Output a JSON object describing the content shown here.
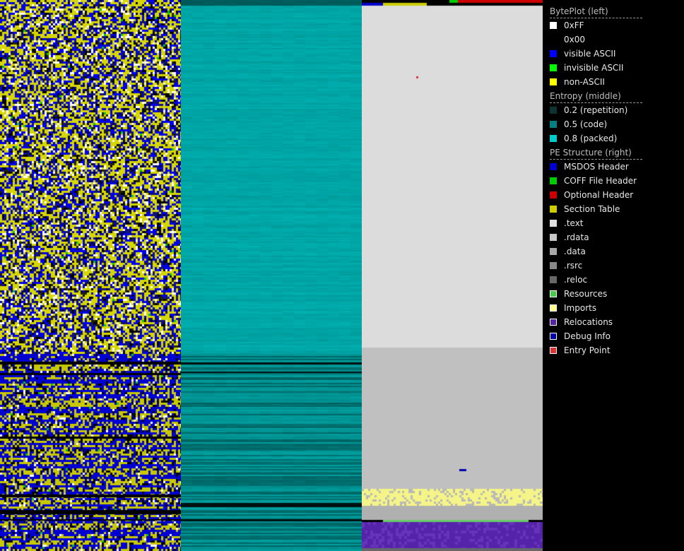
{
  "legend": {
    "sections": [
      {
        "title": "BytePlot (left)",
        "items": [
          {
            "label": "0xFF",
            "color": "#ffffff"
          },
          {
            "label": "0x00",
            "color": "#000000"
          },
          {
            "label": "visible ASCII",
            "color": "#0000ff"
          },
          {
            "label": "invisible ASCII",
            "color": "#00ff00"
          },
          {
            "label": "non-ASCII",
            "color": "#ffff00"
          }
        ]
      },
      {
        "title": "Entropy (middle)",
        "items": [
          {
            "label": "0.2 (repetition)",
            "color": "#0d3333"
          },
          {
            "label": "0.5 (code)",
            "color": "#008080"
          },
          {
            "label": "0.8 (packed)",
            "color": "#00cccc"
          }
        ]
      },
      {
        "title": "PE Structure (right)",
        "items": [
          {
            "label": "MSDOS Header",
            "color": "#0000cc"
          },
          {
            "label": "COFF File Header",
            "color": "#00cc00"
          },
          {
            "label": "Optional Header",
            "color": "#cc0000"
          },
          {
            "label": "Section Table",
            "color": "#cccc00"
          },
          {
            "label": ".text",
            "color": "#e0e0e0"
          },
          {
            "label": ".rdata",
            "color": "#c8c8c8"
          },
          {
            "label": ".data",
            "color": "#a8a8a8"
          },
          {
            "label": ".rsrc",
            "color": "#888888"
          },
          {
            "label": ".reloc",
            "color": "#686868"
          },
          {
            "label": "Resources",
            "color": "#44cc44",
            "outline": "#ffffff"
          },
          {
            "label": "Imports",
            "color": "#ffff88",
            "outline": "#ffffff"
          },
          {
            "label": "Relocations",
            "color": "#5522aa",
            "outline": "#ffffff"
          },
          {
            "label": "Debug Info",
            "color": "#0000aa",
            "outline": "#ffffff"
          },
          {
            "label": "Entry Point",
            "color": "#dd3333",
            "outline": "#ffffff"
          }
        ]
      }
    ]
  }
}
